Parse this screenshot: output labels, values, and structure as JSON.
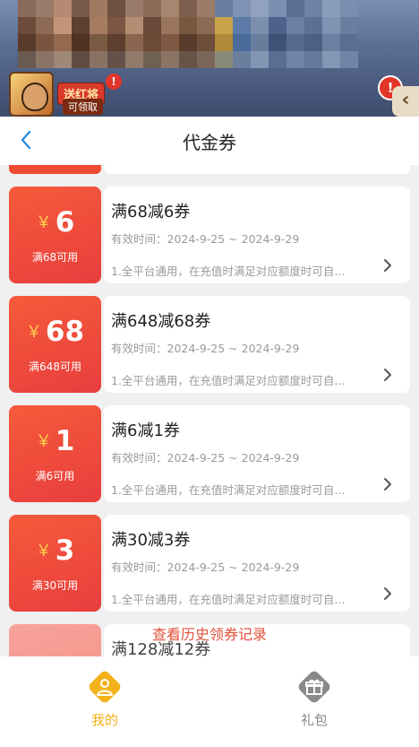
{
  "banner": {
    "promo_tag": "送红将",
    "promo_sub": "可领取",
    "promo_badge": "!",
    "alert_badge": "!",
    "arrow": "‹"
  },
  "header": {
    "back_icon": "chevron-left-icon",
    "title": "代金券"
  },
  "coupons": [
    {
      "amount": "6",
      "condition": "满68可用",
      "name": "满68减6券",
      "validity": "有效时间：2024-9-25 ~ 2024-9-29",
      "description": "1.全平台通用，在充值时满足对应额度时可自..."
    },
    {
      "amount": "68",
      "condition": "满648可用",
      "name": "满648减68券",
      "validity": "有效时间：2024-9-25 ~ 2024-9-29",
      "description": "1.全平台通用，在充值时满足对应额度时可自..."
    },
    {
      "amount": "1",
      "condition": "满6可用",
      "name": "满6减1券",
      "validity": "有效时间：2024-9-25 ~ 2024-9-29",
      "description": "1.全平台通用，在充值时满足对应额度时可自..."
    },
    {
      "amount": "3",
      "condition": "满30可用",
      "name": "满30减3券",
      "validity": "有效时间：2024-9-25 ~ 2024-9-29",
      "description": "1.全平台通用，在充值时满足对应额度时可自..."
    },
    {
      "amount": "",
      "condition": "",
      "name": "满128减12券",
      "validity": "",
      "description": ""
    }
  ],
  "currency_symbol": "￥",
  "history_link": "查看历史领券记录",
  "bottom_nav": {
    "mine_label": "我的",
    "gift_label": "礼包"
  },
  "colors": {
    "accent": "#f3b21b",
    "coupon_red": "#f04a32",
    "link_red": "#e3523a",
    "header_blue": "#2a8ee0"
  }
}
